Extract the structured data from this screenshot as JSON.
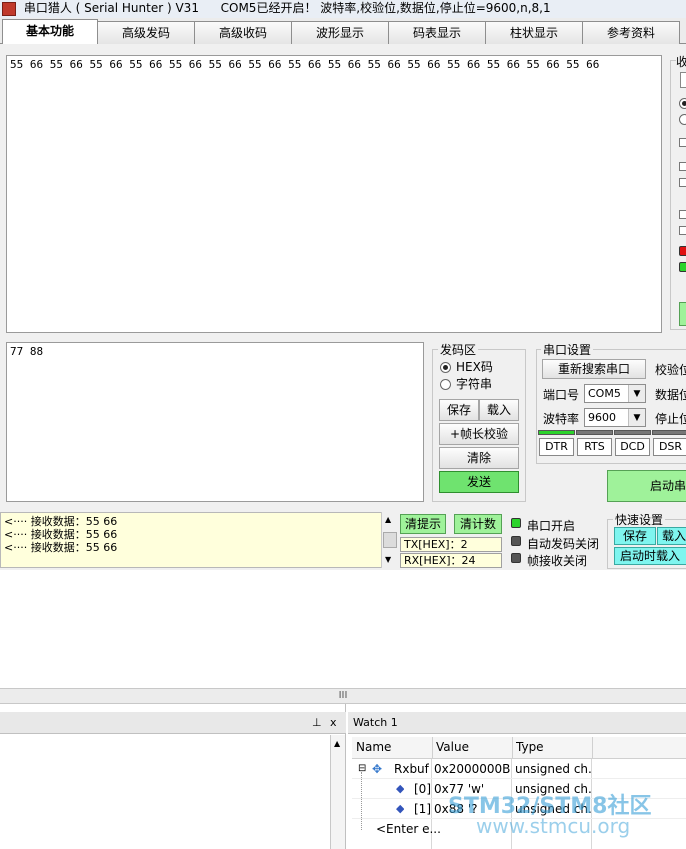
{
  "window": {
    "title": "串口猎人 ( Serial Hunter ) V31",
    "status": "COM5已经开启！ 波特率,校验位,数据位,停止位=9600,n,8,1"
  },
  "tabs": [
    "基本功能",
    "高级发码",
    "高级收码",
    "波形显示",
    "码表显示",
    "柱状显示",
    "参考资料"
  ],
  "receive_area": {
    "content": "55 66 55 66 55 66 55 66 55 66 55 66 55 66 55 66 55 66 55 66 55 66 55 66 55 66 55 66 55 66"
  },
  "send_area": {
    "content": "77 88"
  },
  "send_group": {
    "title": "发码区",
    "hex_label": "HEX码",
    "string_label": "字符串",
    "save": "保存",
    "load": "载入",
    "frame_check": "+帧长校验",
    "clear": "清除",
    "send": "发送"
  },
  "port_settings": {
    "title": "串口设置",
    "rescan": "重新搜索串口",
    "parity_label": "校验位",
    "port_label": "端口号",
    "port_value": "COM5",
    "databits_label": "数据位",
    "baud_label": "波特率",
    "baud_value": "9600",
    "stopbits_label": "停止位",
    "signals": [
      {
        "label": "DTR",
        "on": true
      },
      {
        "label": "RTS",
        "on": false
      },
      {
        "label": "DCD",
        "on": false
      },
      {
        "label": "DSR",
        "on": false
      }
    ],
    "auto_button": "启动串"
  },
  "right_panel_label": "收",
  "log": {
    "lines": [
      "<···· 接收数据：55 66",
      "<···· 接收数据：55 66",
      "<···· 接收数据：55 66"
    ]
  },
  "counters": {
    "clear_tip": "清提示",
    "clear_count": "清计数",
    "tx_label": "TX[HEX]：",
    "tx_value": "2",
    "rx_label": "RX[HEX]：",
    "rx_value": "24"
  },
  "status_leds": {
    "port_open": "串口开启",
    "auto_send_off": "自动发码关闭",
    "frame_recv_off": "帧接收关闭"
  },
  "quick_settings": {
    "title": "快速设置",
    "save": "保存",
    "load": "载入",
    "load_on_start": "启动时载入"
  },
  "splitter_grip": "III",
  "watch": {
    "title": "Watch 1",
    "pin": "ᵖ",
    "close": "x",
    "columns": [
      "Name",
      "Value",
      "Type"
    ],
    "rows": [
      {
        "name": "Rxbuf",
        "value": "0x2000000B ...",
        "type": "unsigned ch..."
      },
      {
        "name": "[0]",
        "value": "0x77 'w'",
        "type": "unsigned ch..."
      },
      {
        "name": "[1]",
        "value": "0x88 '?",
        "type": "unsigned ch..."
      }
    ],
    "enter_placeholder": "<Enter e..."
  },
  "watermark": {
    "brand": "STM32/STM8社区",
    "url": "www.stmcu.org"
  },
  "colors": {
    "send_button": "#6fe36f",
    "log_background": "#ffffdc",
    "led_green": "#2bd32b",
    "led_red": "#e01010",
    "watermark": "#3aa0d8"
  }
}
